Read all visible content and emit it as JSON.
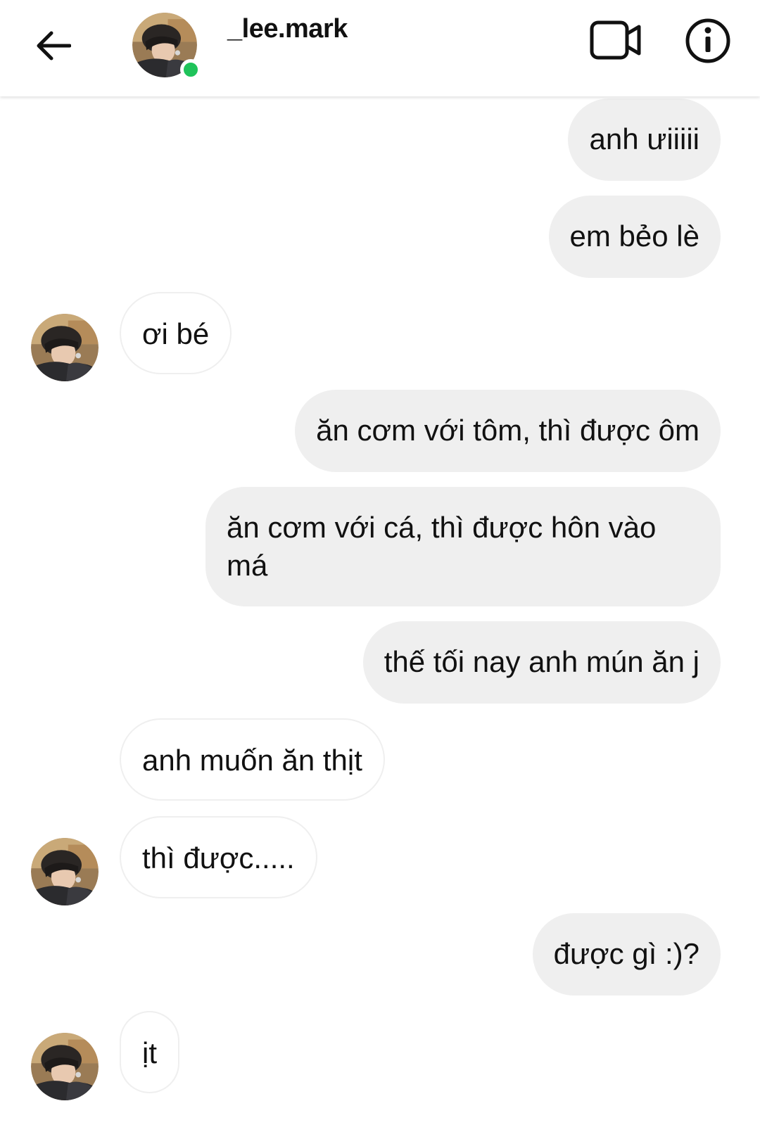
{
  "header": {
    "username": "_lee.mark",
    "online": true,
    "back_icon": "arrow-left-icon",
    "video_icon": "video-camera-icon",
    "info_icon": "info-circle-icon"
  },
  "messages": [
    {
      "side": "sent",
      "text": "anh ưiiiii"
    },
    {
      "side": "sent",
      "text": "em bẻo lè"
    },
    {
      "side": "received",
      "text": "ơi bé"
    },
    {
      "side": "sent",
      "text": "ăn cơm với tôm, thì được ôm"
    },
    {
      "side": "sent",
      "text": "ăn cơm với cá, thì được hôn vào má"
    },
    {
      "side": "sent",
      "text": "thế tối nay anh mún ăn j"
    },
    {
      "side": "received",
      "text": "anh muốn ăn thịt"
    },
    {
      "side": "received",
      "text": "thì được....."
    },
    {
      "side": "sent",
      "text": "được gì :)?"
    },
    {
      "side": "received",
      "text": "ịt"
    }
  ],
  "colors": {
    "sent_bubble": "#efefef",
    "received_border": "#efefef",
    "online_dot": "#1fc35a",
    "text": "#111111"
  }
}
